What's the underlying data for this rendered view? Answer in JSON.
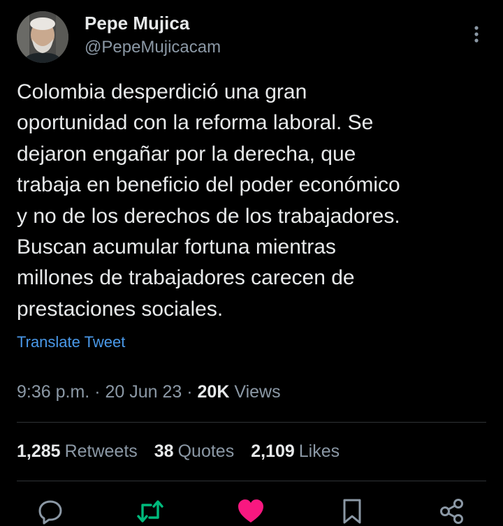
{
  "author": {
    "name": "Pepe Mujica",
    "handle": "@PepeMujicacam"
  },
  "tweet": {
    "text": "Colombia desperdició una gran\noportunidad con la reforma laboral. Se\ndejaron engañar por la derecha, que\ntrabaja en beneficio del poder económico\ny no de los derechos de los trabajadores.\nBuscan acumular fortuna mientras\nmillones de trabajadores carecen de\nprestaciones sociales.",
    "translate_label": "Translate Tweet",
    "time": "9:36 p.m.",
    "date": "20 Jun 23",
    "views_count": "20K",
    "views_label": "Views",
    "separator": "·"
  },
  "stats": {
    "retweets_count": "1,285",
    "retweets_label": "Retweets",
    "quotes_count": "38",
    "quotes_label": "Quotes",
    "likes_count": "2,109",
    "likes_label": "Likes"
  },
  "icons": {
    "reply": "reply-icon",
    "retweet": "retweet-icon",
    "like": "heart-icon",
    "bookmark": "bookmark-icon",
    "share": "share-icon",
    "more": "more-icon"
  },
  "colors": {
    "background": "#000000",
    "text": "#e7e9ea",
    "secondary": "#8b98a5",
    "link": "#4a99e9",
    "retweet_active": "#00ba7c",
    "like_active": "#f91880"
  }
}
